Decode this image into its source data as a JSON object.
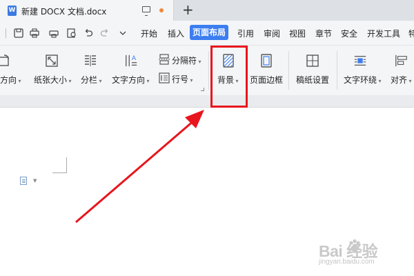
{
  "tab": {
    "title": "新建 DOCX 文档.docx",
    "icon_letter": "W",
    "new_tab_symbol": "+"
  },
  "menu": {
    "items": [
      "开始",
      "插入",
      "页面布局",
      "引用",
      "审阅",
      "视图",
      "章节",
      "安全",
      "开发工具",
      "特"
    ],
    "active": "页面布局",
    "active_color": "#3c7ef0"
  },
  "ribbon": {
    "orientation": "方向",
    "paper_size": "纸张大小",
    "columns": "分栏",
    "text_direction": "文字方向",
    "breaks": "分隔符",
    "line_numbers": "行号",
    "background": "背景",
    "page_border": "页面边框",
    "manuscript_setup": "稿纸设置",
    "text_wrap": "文字环绕",
    "align": "对齐"
  },
  "annotation": {
    "highlight_color": "#e8151c",
    "highlighted_tool": "背景"
  },
  "watermark": {
    "brand": "Bai  经验",
    "url": "jingyan.baidu.com"
  }
}
